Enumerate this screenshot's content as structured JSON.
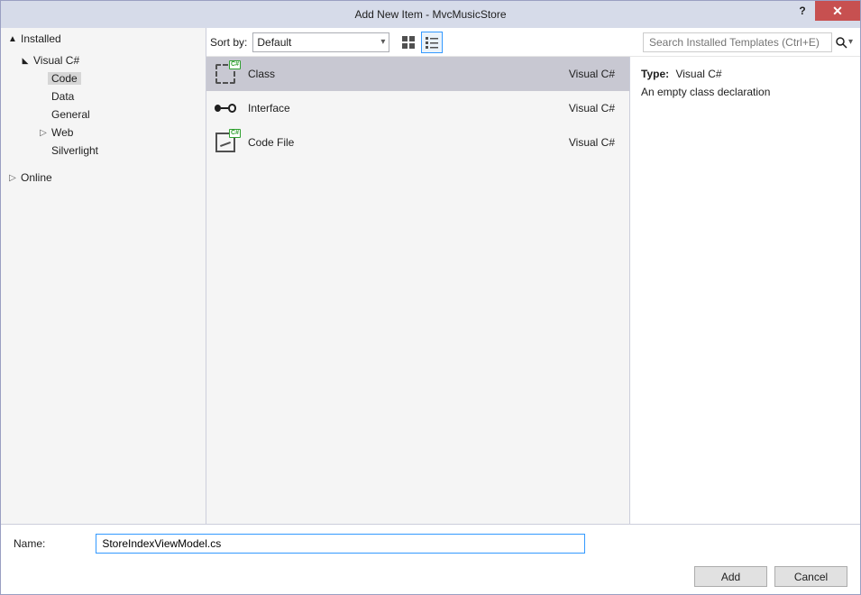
{
  "titlebar": {
    "title": "Add New Item - MvcMusicStore",
    "help_label": "?",
    "close_label": "✕"
  },
  "sidebar": {
    "header": "Installed",
    "items": [
      {
        "label": "Visual C#",
        "depth": 1,
        "caret": "open"
      },
      {
        "label": "Code",
        "depth": 2,
        "selected": true
      },
      {
        "label": "Data",
        "depth": 2
      },
      {
        "label": "General",
        "depth": 2
      },
      {
        "label": "Web",
        "depth": 2,
        "caret": "closed"
      },
      {
        "label": "Silverlight",
        "depth": 2
      },
      {
        "label": "Online",
        "depth": 0,
        "caret": "closed",
        "gap": true
      }
    ]
  },
  "sortbar": {
    "label": "Sort by:",
    "value": "Default"
  },
  "search": {
    "placeholder": "Search Installed Templates (Ctrl+E)"
  },
  "templates": [
    {
      "name": "Class",
      "language": "Visual C#",
      "selected": true,
      "icon": "class-icon"
    },
    {
      "name": "Interface",
      "language": "Visual C#",
      "icon": "interface-icon"
    },
    {
      "name": "Code File",
      "language": "Visual C#",
      "icon": "codefile-icon"
    }
  ],
  "info": {
    "type_label": "Type:",
    "type_value": "Visual C#",
    "description": "An empty class declaration"
  },
  "footer": {
    "name_label": "Name:",
    "name_value": "StoreIndexViewModel.cs",
    "add_label": "Add",
    "cancel_label": "Cancel"
  }
}
